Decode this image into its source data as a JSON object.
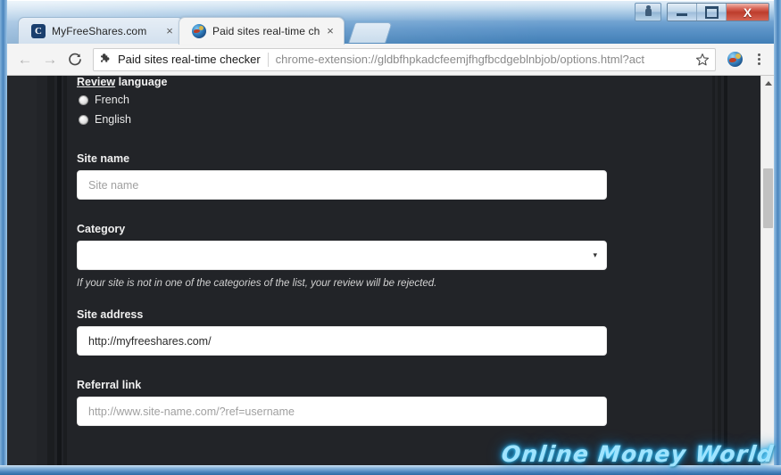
{
  "window": {
    "controls": {
      "user_label": "User",
      "minimize_label": "Minimize",
      "maximize_label": "Maximize",
      "close_label": "X"
    }
  },
  "tabs": [
    {
      "title": "MyFreeShares.com",
      "favicon": "letter-c-icon",
      "favicon_text": "C",
      "close_label": "×",
      "active": false
    },
    {
      "title": "Paid sites real-time check",
      "favicon": "globe-icon",
      "favicon_text": "",
      "close_label": "×",
      "active": true
    }
  ],
  "newtab": {
    "label": ""
  },
  "toolbar": {
    "back_label": "←",
    "forward_label": "→",
    "reload_label": "↻",
    "omnibox": {
      "extension_name": "Paid sites real-time checker",
      "url": "chrome-extension://gldbfhpkadcfeemjfhgfbcdgeblnbjob/options.html?act",
      "star_label": "☆"
    },
    "extension_button_label": "",
    "menu_label": ""
  },
  "page": {
    "review_language": {
      "legend_underlined": "Review",
      "legend_rest": " language",
      "options": [
        {
          "label": "French",
          "selected": false
        },
        {
          "label": "English",
          "selected": false
        }
      ]
    },
    "site_name": {
      "label": "Site name",
      "value": "",
      "placeholder": "Site name"
    },
    "category": {
      "label": "Category",
      "value": "",
      "caret": "▾",
      "hint": "If your site is not in one of the categories of the list, your review will be rejected."
    },
    "site_address": {
      "label": "Site address",
      "value": "http://myfreeshares.com/",
      "placeholder": ""
    },
    "referral_link": {
      "label": "Referral link",
      "value": "",
      "placeholder": "http://www.site-name.com/?ref=username"
    }
  },
  "scrollbar": {
    "up_arrow_label": "▲"
  },
  "watermark": {
    "text": "Online Money World"
  },
  "colors": {
    "page_background": "#222428",
    "titlebar_blue": "#5e95c9",
    "close_red": "#bd3d2c",
    "watermark_cyan": "#9fe4ff",
    "input_white": "#ffffff",
    "scrollbar_thumb": "#c1c1c1"
  }
}
